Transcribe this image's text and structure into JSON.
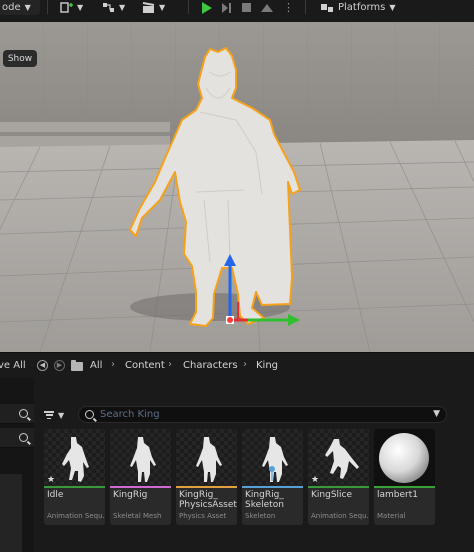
{
  "toolbar": {
    "mode_label": "ode",
    "platforms_label": "Platforms"
  },
  "viewport": {
    "show_label": "Show"
  },
  "content_browser": {
    "save_label": "ve All",
    "breadcrumbs": [
      "All",
      "Content",
      "Characters",
      "King"
    ],
    "search_placeholder": "Search King",
    "assets": [
      {
        "name": "Idle",
        "type": "Animation Sequ...",
        "stripe_color": "#3a9a3a",
        "starred": true
      },
      {
        "name": "KingRig",
        "type": "Skeletal Mesh",
        "stripe_color": "#d06ad0",
        "starred": false
      },
      {
        "name": "KingRig_PhysicsAsset",
        "name_line1": "KingRig_",
        "name_line2": "PhysicsAsset",
        "type": "Physics Asset",
        "stripe_color": "#e0a040",
        "starred": false
      },
      {
        "name": "KingRig_Skeleton",
        "name_line1": "KingRig_",
        "name_line2": "Skeleton",
        "type": "Skeleton",
        "stripe_color": "#58a0d8",
        "starred": false
      },
      {
        "name": "KingSlice",
        "type": "Animation Sequ...",
        "stripe_color": "#3a9a3a",
        "starred": true
      },
      {
        "name": "lambert1",
        "type": "Material",
        "stripe_color": "#3aa03a",
        "starred": false
      }
    ]
  }
}
